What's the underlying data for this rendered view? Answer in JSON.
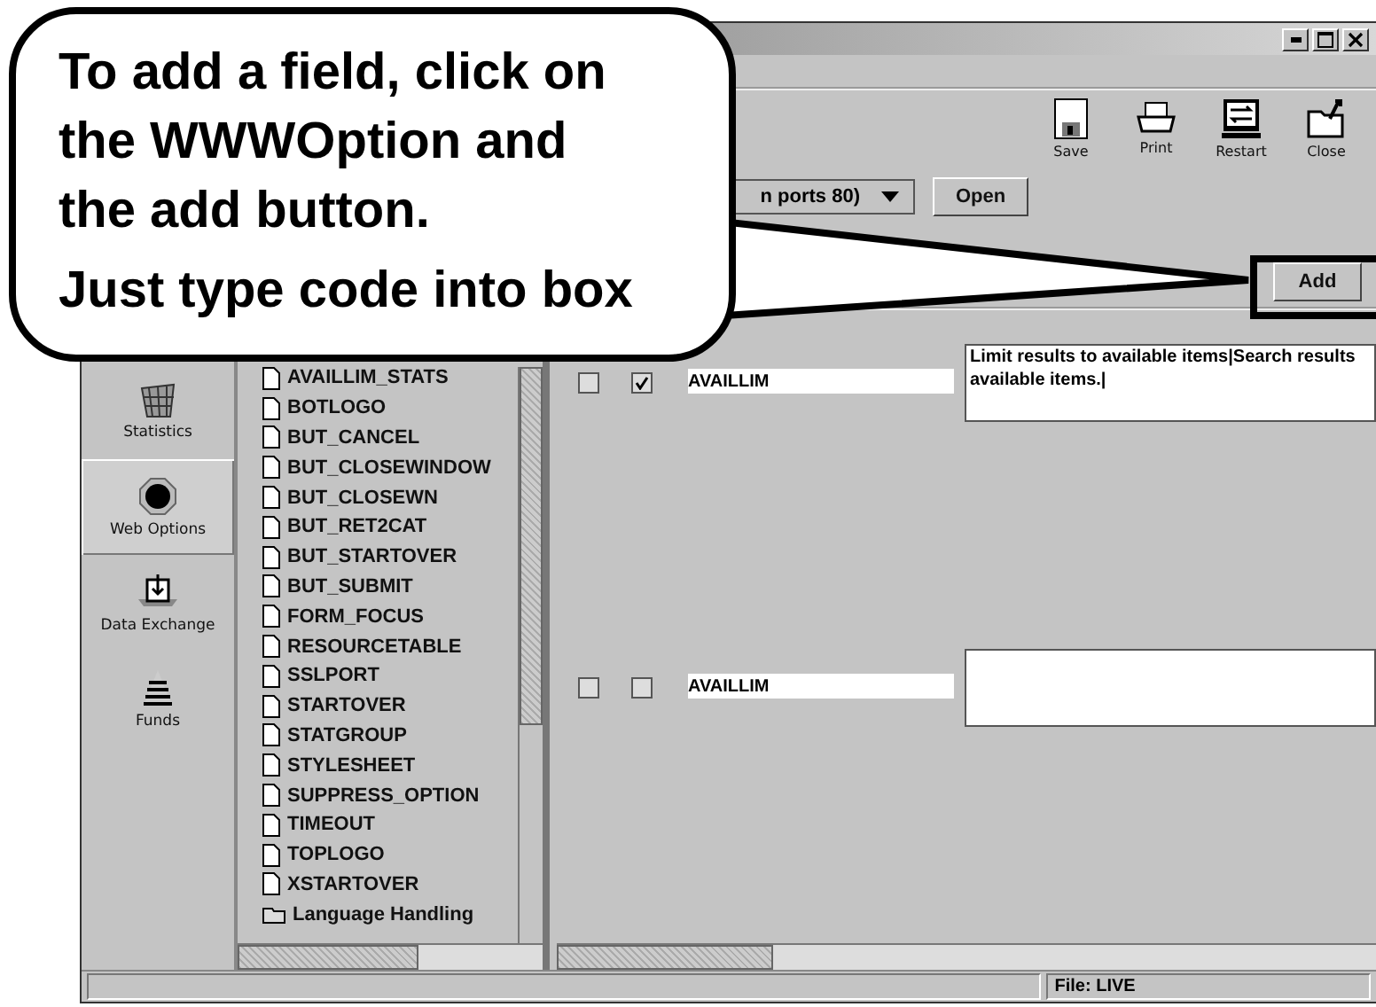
{
  "toolbar": {
    "buttons": [
      {
        "label": "Save"
      },
      {
        "label": "Print"
      },
      {
        "label": "Restart"
      },
      {
        "label": "Close"
      }
    ]
  },
  "server_select": {
    "value": "n ports 80)",
    "button": "Open"
  },
  "add_button": "Add",
  "nav": [
    {
      "label": "Statistics",
      "selected": false
    },
    {
      "label": "Web Options",
      "selected": true
    },
    {
      "label": "Data Exchange",
      "selected": false
    },
    {
      "label": "Funds",
      "selected": false
    }
  ],
  "tree": [
    {
      "label": "AVAILLIM_STATS",
      "kind": "file"
    },
    {
      "label": "BOTLOGO",
      "kind": "file"
    },
    {
      "label": "BUT_CANCEL",
      "kind": "file"
    },
    {
      "label": "BUT_CLOSEWINDOW",
      "kind": "file"
    },
    {
      "label": "BUT_CLOSEWN",
      "kind": "file"
    },
    {
      "label": "BUT_RET2CAT",
      "kind": "file"
    },
    {
      "label": "BUT_STARTOVER",
      "kind": "file"
    },
    {
      "label": "BUT_SUBMIT",
      "kind": "file"
    },
    {
      "label": "FORM_FOCUS",
      "kind": "file"
    },
    {
      "label": "RESOURCETABLE",
      "kind": "file"
    },
    {
      "label": "SSLPORT",
      "kind": "file"
    },
    {
      "label": "STARTOVER",
      "kind": "file"
    },
    {
      "label": "STATGROUP",
      "kind": "file"
    },
    {
      "label": "STYLESHEET",
      "kind": "file"
    },
    {
      "label": "SUPPRESS_OPTION",
      "kind": "file"
    },
    {
      "label": "TIMEOUT",
      "kind": "file"
    },
    {
      "label": "TOPLOGO",
      "kind": "file"
    },
    {
      "label": "XSTARTOVER",
      "kind": "file"
    },
    {
      "label": "Language Handling",
      "kind": "folder"
    }
  ],
  "options": [
    {
      "checkbox_1": false,
      "checkbox_2": true,
      "name": "AVAILLIM",
      "description": "Limit results to available items|Search results available items.|"
    },
    {
      "checkbox_1": false,
      "checkbox_2": false,
      "name": "AVAILLIM"
    }
  ],
  "status_bar": {
    "file": "File: LIVE"
  },
  "callout": {
    "paragraphs": [
      "To add a field, click on the WWWOption and the add button.",
      "Just type code into box"
    ]
  }
}
